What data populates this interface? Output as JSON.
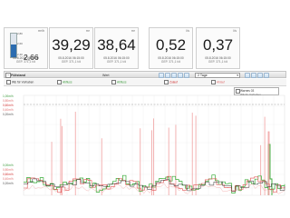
{
  "gauge": {
    "unit": "m³/h",
    "tick_top": "2,80",
    "tick_mid": "2,60",
    "tick_bottom": "2,40",
    "value": "2,66",
    "fill_fraction": 0.55,
    "fill_color": "#2b6cb0"
  },
  "cards": [
    {
      "unit": "m³",
      "value": "39,29",
      "timestamp": "05.8.2016 06:15:00",
      "range": "GEP. 371,1 t/d"
    },
    {
      "unit": "m³",
      "value": "38,64",
      "timestamp": "05.8.2016 06:15:00",
      "range": "GEP. 371,1 t/d"
    },
    {
      "unit": "l/s",
      "value": "0,52",
      "timestamp": "05.8.2016 06:15:00",
      "range": "GEP. 371,1 t/d"
    },
    {
      "unit": "l/s",
      "value": "0,37",
      "timestamp": "05.8.2016 06:15:00",
      "range": "GEP. 371,1 t/d"
    }
  ],
  "gauge_timestamp": "05.8.2016 06:15:00",
  "gauge_range": "GEP. 371,1 t/d",
  "toolbar": {
    "title": "Füllstand",
    "mode_label": "Wert",
    "period_select": "2 Tage"
  },
  "tags": [
    {
      "label": "Abfluss",
      "sub": "WE für Vorhaben",
      "color": "#333333"
    },
    {
      "label": "Abfluss",
      "sub": "WE für Vorhaben",
      "color": "#3a9a3a"
    },
    {
      "label": "Abfluss",
      "sub": "WE für Vorhaben",
      "color": "#3a9a3a"
    },
    {
      "label": "Zulauf",
      "sub": "WE für Vorhaben",
      "color": "#d03030"
    },
    {
      "label": "Ablauf",
      "sub": "WE für Vorhaben",
      "color": "#e07070"
    }
  ],
  "legend_popup": {
    "label": "Warnes 03",
    "sub": "WE für Vorhaben"
  },
  "axis_upper": [
    "1,00m/h",
    "0,80m/h",
    "0,60m/h",
    "0,40m/h",
    "0,20m/h"
  ],
  "axis_lower": [
    "0,00m/h",
    "0,80m/h",
    "0,60m/h",
    "0,40m/h",
    "0,20m/h"
  ],
  "axis_colors": [
    "#3a9a3a",
    "#e07070",
    "#d03030",
    "#e07070",
    "#555555"
  ],
  "colors": {
    "green": "#33aa33",
    "red": "#e05050",
    "dark": "#333333",
    "pink": "#f0a0a0"
  }
}
